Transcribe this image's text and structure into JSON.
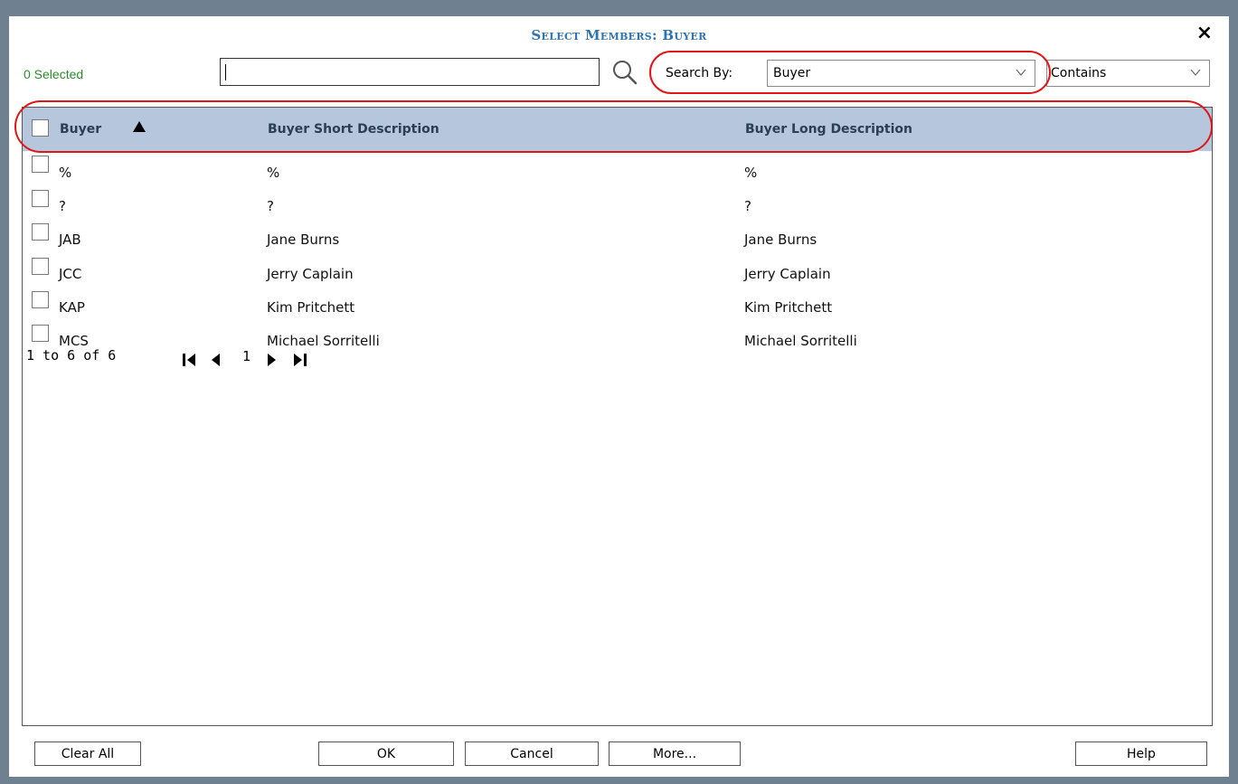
{
  "dialog": {
    "title": "Select Members: Buyer",
    "close_label": "×"
  },
  "toolbar": {
    "selected_count": "0 Selected",
    "search_value": "",
    "search_by_label": "Search By:",
    "search_by_value": "Buyer",
    "match_mode_value": "Contains"
  },
  "grid": {
    "columns": [
      "Buyer",
      "Buyer Short Description",
      "Buyer Long Description"
    ],
    "sort_column": "Buyer",
    "sort_direction": "ascending",
    "rows": [
      [
        "%",
        "%",
        "%"
      ],
      [
        "?",
        "?",
        "?"
      ],
      [
        "JAB",
        "Jane Burns",
        "Jane Burns"
      ],
      [
        "JCC",
        "Jerry Caplain",
        "Jerry Caplain"
      ],
      [
        "KAP",
        "Kim Pritchett",
        "Kim Pritchett"
      ],
      [
        "MCS",
        "Michael Sorritelli",
        "Michael Sorritelli"
      ]
    ]
  },
  "pager": {
    "range_text": "1 to 6 of 6",
    "current_page": "1"
  },
  "buttons": {
    "clear_all": "Clear All",
    "ok": "OK",
    "cancel": "Cancel",
    "more": "More...",
    "help": "Help"
  },
  "colors": {
    "title": "#2f73b3",
    "selected_count": "#2e8b2e",
    "header_bg": "#b5c6dd",
    "header_text": "#2c3e54",
    "highlight_oval": "#e01515",
    "backdrop": "#6f8091"
  },
  "icons": {
    "search": "magnifier-icon",
    "sort": "triangle-up-icon",
    "pager_first": "first-page-icon",
    "pager_prev": "prev-page-icon",
    "pager_next": "next-page-icon",
    "pager_last": "last-page-icon"
  }
}
